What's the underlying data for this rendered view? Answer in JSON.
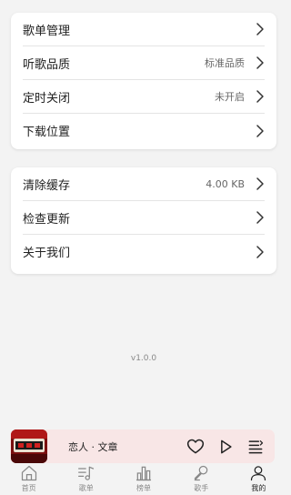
{
  "settings_group1": [
    {
      "label": "歌单管理",
      "value": ""
    },
    {
      "label": "听歌品质",
      "value": "标准品质"
    },
    {
      "label": "定时关闭",
      "value": "未开启"
    },
    {
      "label": "下载位置",
      "value": ""
    }
  ],
  "settings_group2": [
    {
      "label": "清除缓存",
      "value": "4.00 KB"
    },
    {
      "label": "检查更新",
      "value": ""
    },
    {
      "label": "关于我们",
      "value": ""
    }
  ],
  "version": "v1.0.0",
  "player": {
    "song": "恋人 · 文章",
    "cover_icon": "album-cover",
    "buttons": [
      "heart-icon",
      "play-icon",
      "playlist-icon"
    ]
  },
  "tabs": [
    {
      "label": "首页",
      "icon": "home-icon"
    },
    {
      "label": "歌单",
      "icon": "music-list-icon"
    },
    {
      "label": "榜单",
      "icon": "chart-icon"
    },
    {
      "label": "歌手",
      "icon": "microphone-icon"
    },
    {
      "label": "我的",
      "icon": "user-icon"
    }
  ],
  "active_tab": "我的",
  "colors": {
    "background": "#f3f3f3",
    "card": "#ffffff",
    "player_bg": "#f8e6e6",
    "tab_active": "#222222",
    "tab_inactive": "#888888"
  }
}
